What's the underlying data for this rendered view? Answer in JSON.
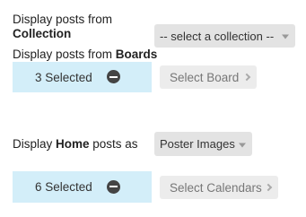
{
  "collection": {
    "label_pre": "Display posts from",
    "label_bold": "Collection",
    "select_value": "-- select a collection --"
  },
  "boards": {
    "label_pre": "Display posts from ",
    "label_bold": "Boards",
    "selected_text": "3 Selected",
    "button_label": "Select Board"
  },
  "home": {
    "label_pre": "Display ",
    "label_bold": "Home",
    "label_post": " posts as",
    "select_value": "Poster Images"
  },
  "calendars": {
    "selected_text": "6 Selected",
    "button_label": "Select Calendars"
  },
  "icons": {
    "caret": "chevron-down-icon",
    "remove": "minus-circle-icon",
    "chevron": "chevron-right-icon"
  },
  "colors": {
    "selected_bg": "#d3eef9",
    "select_bg": "#e3e3e3",
    "button_bg": "#ececec"
  }
}
